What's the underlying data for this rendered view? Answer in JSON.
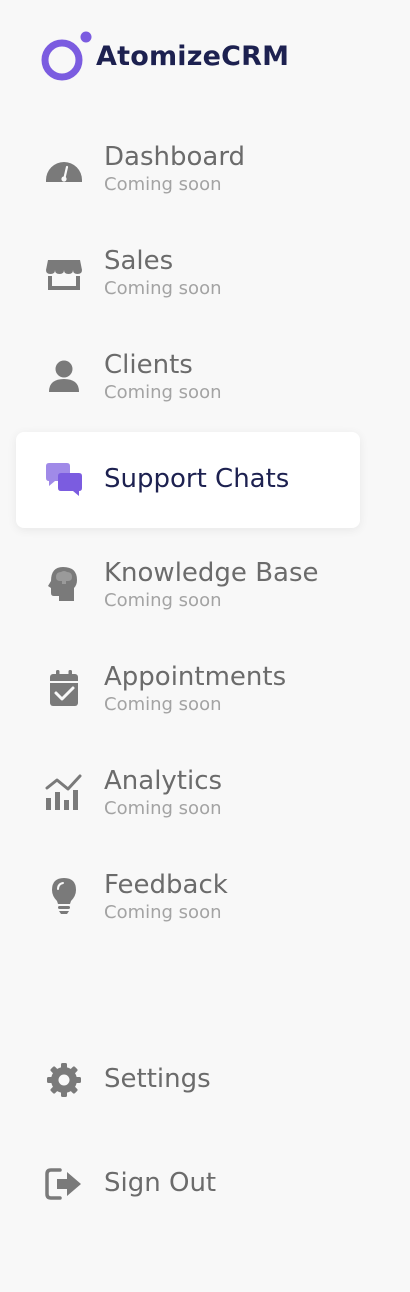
{
  "brand": {
    "name": "AtomizeCRM",
    "accent_color": "#7b5ce0",
    "text_color": "#1d2150"
  },
  "nav": {
    "items": [
      {
        "id": "dashboard",
        "label": "Dashboard",
        "sub": "Coming soon",
        "icon": "gauge-icon",
        "active": false
      },
      {
        "id": "sales",
        "label": "Sales",
        "sub": "Coming soon",
        "icon": "storefront-icon",
        "active": false
      },
      {
        "id": "clients",
        "label": "Clients",
        "sub": "Coming soon",
        "icon": "user-icon",
        "active": false
      },
      {
        "id": "support-chats",
        "label": "Support Chats",
        "sub": "",
        "icon": "chat-bubbles-icon",
        "active": true
      },
      {
        "id": "knowledge-base",
        "label": "Knowledge Base",
        "sub": "Coming soon",
        "icon": "brain-head-icon",
        "active": false
      },
      {
        "id": "appointments",
        "label": "Appointments",
        "sub": "Coming soon",
        "icon": "calendar-check-icon",
        "active": false
      },
      {
        "id": "analytics",
        "label": "Analytics",
        "sub": "Coming soon",
        "icon": "bar-chart-icon",
        "active": false
      },
      {
        "id": "feedback",
        "label": "Feedback",
        "sub": "Coming soon",
        "icon": "lightbulb-icon",
        "active": false
      }
    ],
    "bottom": [
      {
        "id": "settings",
        "label": "Settings",
        "icon": "gear-icon"
      },
      {
        "id": "sign-out",
        "label": "Sign Out",
        "icon": "sign-out-icon"
      }
    ]
  },
  "colors": {
    "icon_inactive": "#7a7a7a",
    "icon_active": "#7b5ce0",
    "label_inactive": "#6b6b6b",
    "label_active": "#1d2150",
    "sub_text": "#a3a3a3",
    "background": "#f8f8f8",
    "active_bg": "#ffffff"
  }
}
